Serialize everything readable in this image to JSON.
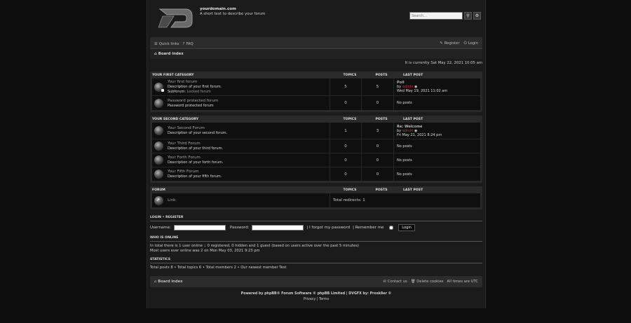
{
  "header": {
    "site_name": "yourdomain.com",
    "site_desc": "A short text to describe your forum",
    "search_placeholder": "Search…"
  },
  "nav": {
    "quick_links": "Quick links",
    "faq": "FAQ",
    "register": "Register",
    "login": "Login",
    "board_index": "Board index"
  },
  "current_time": "It is currently Sat May 22, 2021 10:05 am",
  "columns": {
    "topics": "TOPICS",
    "posts": "POSTS",
    "last_post": "LAST POST",
    "no_posts": "No posts"
  },
  "categories": [
    {
      "name": "YOUR FIRST CATEGORY",
      "forums": [
        {
          "title": "Your first forum",
          "desc": "Description of your first forum.",
          "subforum_label": "Subforum:",
          "subforum": "Locked forum",
          "topics": "5",
          "posts": "5",
          "last_title": "Poll",
          "last_by": "by",
          "last_user": "admin",
          "last_date": "Wed May 19, 2021 11:02 am"
        },
        {
          "title": "Password protected forum",
          "desc": "Password protected forum",
          "topics": "0",
          "posts": "0"
        }
      ]
    },
    {
      "name": "YOUR SECOND CATEGORY",
      "forums": [
        {
          "title": "Your Second Forum",
          "desc": "Description of your second forum.",
          "topics": "1",
          "posts": "3",
          "last_title": "Re: Welcome",
          "last_by": "by",
          "last_user": "admin",
          "last_date": "Fri May 21, 2021 8:24 pm"
        },
        {
          "title": "Your Third Forum",
          "desc": "Description of your third forum.",
          "topics": "0",
          "posts": "0"
        },
        {
          "title": "Your Forth Forum",
          "desc": "Description of your forth forum.",
          "topics": "0",
          "posts": "0"
        },
        {
          "title": "Your Fifth Forum",
          "desc": "Description of your fifth forum.",
          "topics": "0",
          "posts": "0"
        }
      ]
    },
    {
      "name": "FORUM",
      "forums": [
        {
          "title": "Link",
          "redirects": "Total redirects: 1"
        }
      ]
    }
  ],
  "login": {
    "heading_login": "LOGIN",
    "heading_sep": "•",
    "heading_register": "REGISTER",
    "username_label": "Username:",
    "password_label": "Password:",
    "forgot": "| I forgot my password",
    "remember": "| Remember me",
    "button": "Login"
  },
  "online": {
    "heading": "WHO IS ONLINE",
    "line1": "In total there is 1 user online :: 0 registered, 0 hidden and 1 guest (based on users active over the past 5 minutes)",
    "line2": "Most users ever online was 2 on Mon May 03, 2021 9:23 pm"
  },
  "stats": {
    "heading": "STATISTICS",
    "line": "Total posts 8 • Total topics 6 • Total members 2 • Our newest member Test"
  },
  "footer": {
    "board_index": "Board index",
    "contact": "Contact us",
    "delete_cookies": "Delete cookies",
    "timezone": "All times are UTC",
    "credit1": "Powered by phpBB® Forum Software © phpBB Limited | DVGFX by: Prosk8er ©",
    "privacy": "Privacy",
    "sep": "|",
    "terms": "Terms"
  }
}
